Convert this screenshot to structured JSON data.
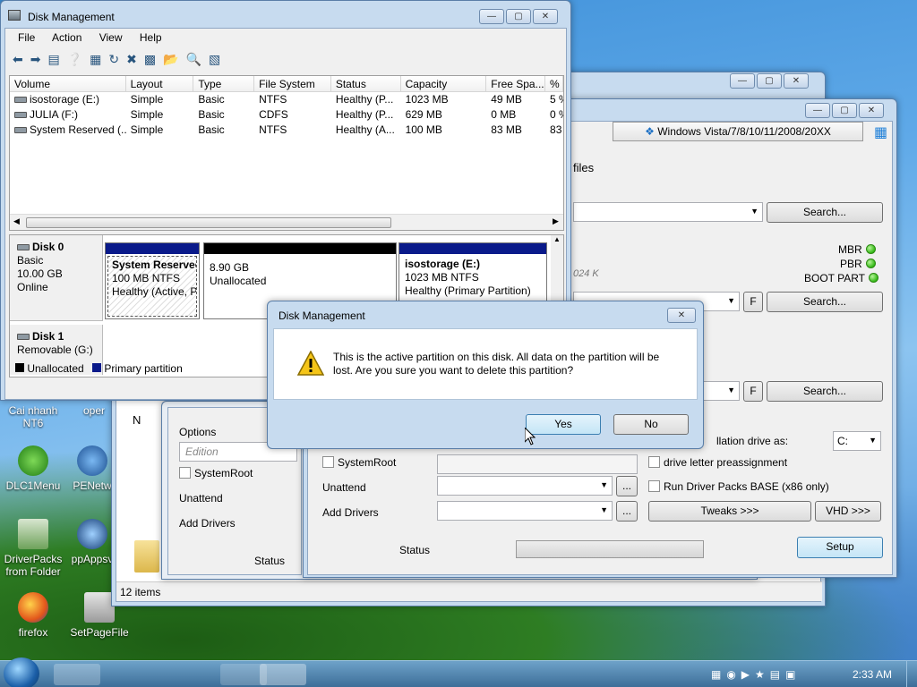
{
  "desktop": {
    "icons": [
      {
        "label": "Cai nhanh NT6"
      },
      {
        "label": "oper"
      },
      {
        "label": "DLC1Menu"
      },
      {
        "label": "PENetw"
      },
      {
        "label": "DriverPacks from Folder"
      },
      {
        "label": "ppAppsv"
      },
      {
        "label": "firefox"
      },
      {
        "label": "SetPageFile"
      }
    ]
  },
  "disk_mgmt": {
    "title": "Disk Management",
    "menu": [
      "File",
      "Action",
      "View",
      "Help"
    ],
    "columns": [
      "Volume",
      "Layout",
      "Type",
      "File System",
      "Status",
      "Capacity",
      "Free Spa...",
      "% F"
    ],
    "volumes": [
      [
        "isostorage (E:)",
        "Simple",
        "Basic",
        "NTFS",
        "Healthy (P...",
        "1023 MB",
        "49 MB",
        "5 %"
      ],
      [
        "JULIA (F:)",
        "Simple",
        "Basic",
        "CDFS",
        "Healthy (P...",
        "629 MB",
        "0 MB",
        "0 %"
      ],
      [
        "System Reserved (...",
        "Simple",
        "Basic",
        "NTFS",
        "Healthy (A...",
        "100 MB",
        "83 MB",
        "83"
      ]
    ],
    "disk0": {
      "name": "Disk 0",
      "type": "Basic",
      "size": "10.00 GB",
      "state": "Online",
      "partitions": [
        {
          "name": "System Reservec",
          "size": "100 MB NTFS",
          "status": "Healthy (Active, P"
        },
        {
          "name": "",
          "size": "8.90 GB",
          "status": "Unallocated"
        },
        {
          "name": "isostorage  (E:)",
          "size": "1023 MB NTFS",
          "status": "Healthy (Primary Partition)"
        }
      ]
    },
    "disk1": {
      "name": "Disk 1",
      "type": "Removable (G:)"
    },
    "legend": {
      "unallocated": "Unallocated",
      "primary": "Primary partition"
    }
  },
  "installer": {
    "os_tab": "Windows Vista/7/8/10/11/2008/20XX",
    "files_label": "files",
    "search_label": "Search...",
    "mbr": "MBR",
    "pbr": "PBR",
    "boot_part": "BOOT PART",
    "size_hint": "024 K",
    "f_button": "F",
    "install_drive_label": "llation drive as:",
    "drive_value": "C:",
    "systemroot": "SystemRoot",
    "drive_letter": "drive letter preassignment",
    "unattend": "Unattend",
    "run_driver_packs": "Run Driver Packs BASE (x86 only)",
    "add_drivers": "Add Drivers",
    "tweaks": "Tweaks >>>",
    "vhd": "VHD >>>",
    "status": "Status",
    "setup": "Setup",
    "ellipsis": "..."
  },
  "back_window": {
    "options": "Options",
    "edition_placeholder": "Edition",
    "systemroot": "SystemRoot",
    "unattend": "Unattend",
    "add_drivers": "Add Drivers",
    "status": "Status",
    "items": "12 items",
    "n_char": "N"
  },
  "dialog": {
    "title": "Disk Management",
    "message": "This is the active partition on this disk. All data on the partition will be lost. Are you sure you want to delete this partition?",
    "yes": "Yes",
    "no": "No"
  },
  "taskbar": {
    "clock": "2:33 AM"
  }
}
